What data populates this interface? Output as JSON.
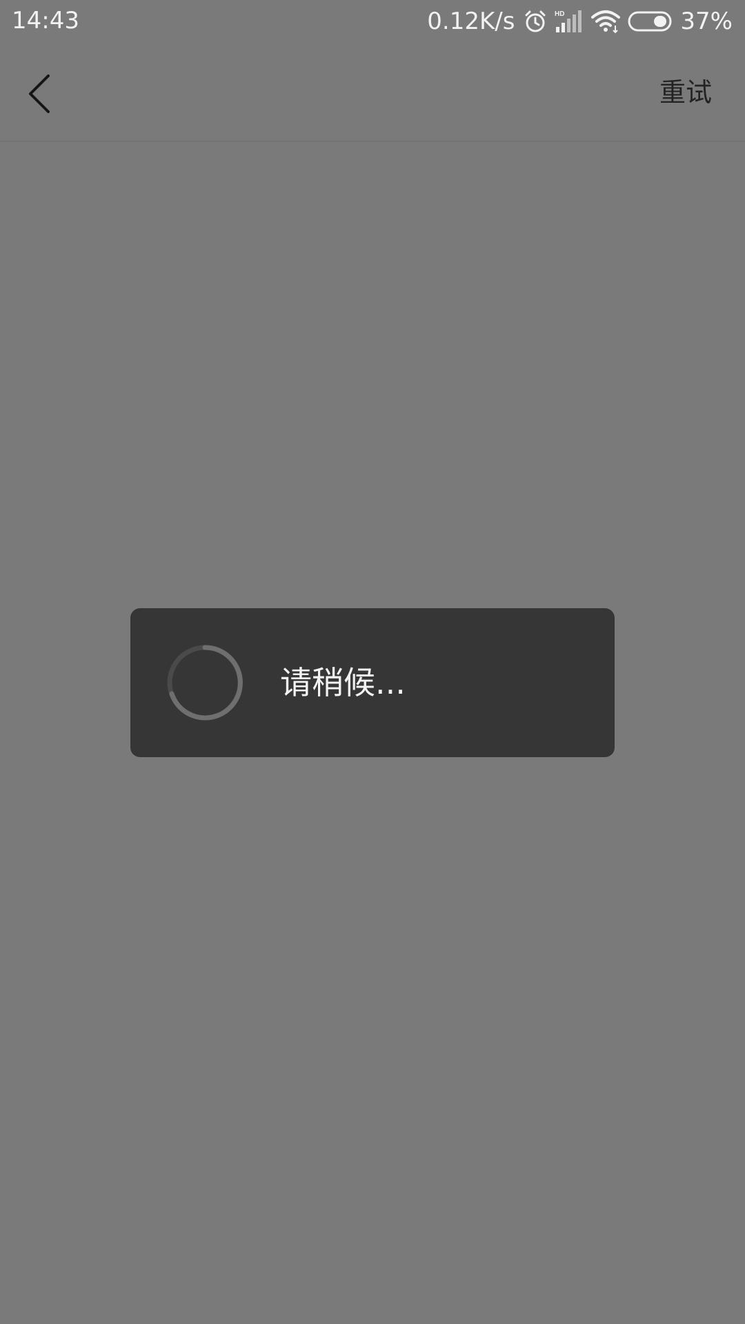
{
  "status_bar": {
    "time": "14:43",
    "net_speed": "0.12K/s",
    "battery_percent": "37%",
    "icons": [
      "alarm-icon",
      "hd-signal-icon",
      "wifi-icon",
      "battery-icon"
    ]
  },
  "nav": {
    "back_icon": "chevron-left-icon",
    "retry_label": "重试"
  },
  "dialog": {
    "message": "请稍候...",
    "spinner_icon": "loading-spinner-icon"
  },
  "colors": {
    "background": "#7a7a7a",
    "dialog_bg": "#363636",
    "text_light": "#f3f3f3",
    "nav_text": "#232323"
  }
}
